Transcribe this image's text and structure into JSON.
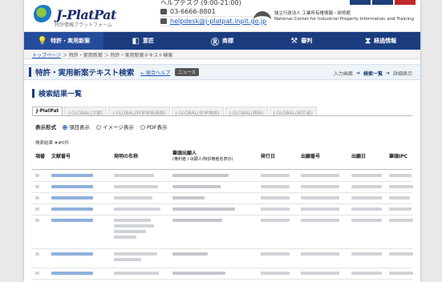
{
  "header": {
    "logo_text": "J-PlatPat",
    "logo_sub": "特許情報プラットフォーム",
    "hours": "ヘルプデスク (9:00-21:00)",
    "phone": "03-6666-8801",
    "email": "helpdesk@j-platpat.inpit.go.jp",
    "org_jp": "独立行政法人 工業所有権情報・研修館",
    "org_en": "National Center for Industrial Property Information and Training"
  },
  "nav": {
    "items": [
      {
        "label": "特許・実用新案",
        "icon": "lightbulb-icon",
        "glyph": "💡"
      },
      {
        "label": "意匠",
        "icon": "design-icon",
        "glyph": "◧"
      },
      {
        "label": "商標",
        "icon": "trademark-icon",
        "glyph": "Ⓡ"
      },
      {
        "label": "審判",
        "icon": "gavel-icon",
        "glyph": "⚒"
      },
      {
        "label": "経過情報",
        "icon": "hourglass-icon",
        "glyph": "⧗"
      }
    ]
  },
  "breadcrumb": {
    "home": "トップページ",
    "trail": "＞ 特許・実用新案 ＞ 特許・実用新案テキスト検索"
  },
  "page": {
    "title": "特許・実用新案テキスト検索",
    "help_link": "← 総合ヘルプ",
    "news_badge": "ニュース",
    "steps": [
      "入力画面",
      "検索一覧",
      "詳細表示"
    ]
  },
  "results": {
    "section_title": "検索結果一覧",
    "tabs": [
      "J-PlatPat",
      "J-GLOBAL(文献)",
      "J-GLOBAL(科学技術用語)",
      "J-GLOBAL(化学物質)",
      "J-GLOBAL(資料)",
      "J-GLOBAL(研究者)"
    ],
    "format_label": "表示形式",
    "format_options": [
      "項目表示",
      "イメージ表示",
      "PDF表示"
    ],
    "hit_count": "検索結果 ##0件",
    "columns": {
      "no": "項番",
      "doc_no": "文献番号",
      "invention_title": "発明の名称",
      "applicant": "筆頭出願人",
      "applicant_sub": "(権利者 / 出願人/特許権者名表示)",
      "pub_date": "発行日",
      "app_no": "出願番号",
      "app_date": "出願日",
      "ipc": "筆頭IPC"
    }
  }
}
